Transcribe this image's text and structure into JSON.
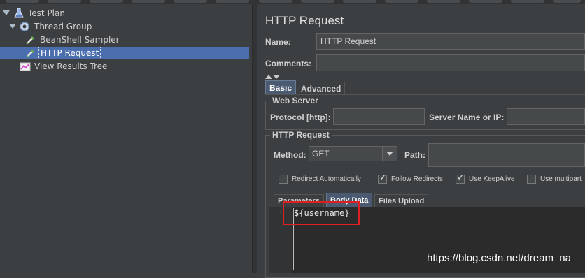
{
  "tree": {
    "items": [
      {
        "label": "Test Plan",
        "icon": "flask-icon"
      },
      {
        "label": "Thread Group",
        "icon": "gear-icon"
      },
      {
        "label": "BeanShell Sampler",
        "icon": "pipette-icon"
      },
      {
        "label": "HTTP Request",
        "icon": "pipette-icon",
        "selected": true
      },
      {
        "label": "View Results Tree",
        "icon": "chart-icon"
      }
    ]
  },
  "panel": {
    "title": "HTTP Request",
    "name_label": "Name:",
    "name_value": "HTTP Request",
    "comments_label": "Comments:",
    "comments_value": ""
  },
  "tabs": {
    "basic": "Basic",
    "advanced": "Advanced"
  },
  "web_server": {
    "title": "Web Server",
    "protocol_label": "Protocol [http]:",
    "protocol_value": "",
    "server_label": "Server Name or IP:",
    "server_value": ""
  },
  "http_request": {
    "title": "HTTP Request",
    "method_label": "Method:",
    "method_value": "GET",
    "path_label": "Path:",
    "path_value": "",
    "checkboxes": [
      {
        "label": "Redirect Automatically",
        "checked": false
      },
      {
        "label": "Follow Redirects",
        "checked": true
      },
      {
        "label": "Use KeepAlive",
        "checked": true
      },
      {
        "label": "Use multipart",
        "checked": false
      }
    ]
  },
  "body_tabs": {
    "parameters": "Parameters",
    "body_data": "Body Data",
    "files_upload": "Files Upload"
  },
  "editor": {
    "line_number": "1",
    "line_text": "${username}"
  },
  "watermark": "https://blog.csdn.net/dream_na",
  "colors": {
    "background": "#3c3f41",
    "selection": "#4b6eaf",
    "highlight_box": "#e02020"
  }
}
